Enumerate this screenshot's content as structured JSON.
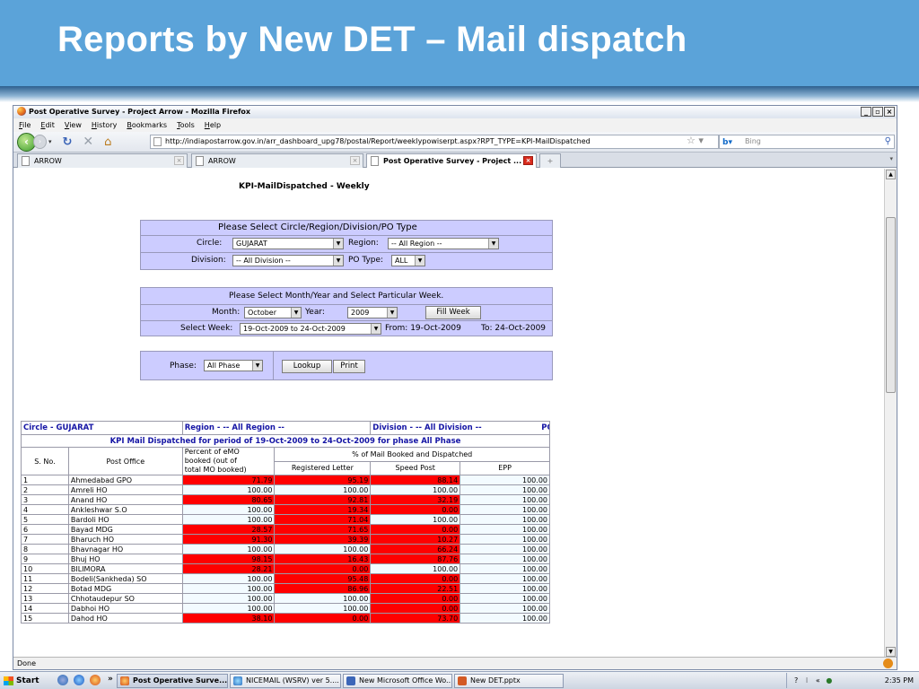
{
  "slide": {
    "title": "Reports by New DET – Mail dispatch"
  },
  "browser": {
    "window_title": "Post Operative Survey - Project Arrow - Mozilla Firefox",
    "menu": [
      "File",
      "Edit",
      "View",
      "History",
      "Bookmarks",
      "Tools",
      "Help"
    ],
    "url": "http://indiapostarrow.gov.in/arr_dashboard_upg78/postal/Report/weeklypowiserpt.aspx?RPT_TYPE=KPI-MailDispatched",
    "search_placeholder": "Bing",
    "tabs": [
      {
        "label": "ARROW"
      },
      {
        "label": "ARROW"
      },
      {
        "label": "Post Operative Survey - Project ...",
        "active": true
      }
    ],
    "new_tab": "+",
    "status": "Done"
  },
  "page": {
    "title": "KPI-MailDispatched - Weekly",
    "select_panel": {
      "header": "Please Select Circle/Region/Division/PO Type",
      "circle_label": "Circle:",
      "circle_value": "GUJARAT",
      "region_label": "Region:",
      "region_value": "-- All Region --",
      "division_label": "Division:",
      "division_value": "-- All Division --",
      "potype_label": "PO Type:",
      "potype_value": "ALL"
    },
    "week_panel": {
      "header": "Please Select Month/Year and Select Particular Week.",
      "month_label": "Month:",
      "month_value": "October",
      "year_label": "Year:",
      "year_value": "2009",
      "fill_week": "Fill Week",
      "select_week_label": "Select Week:",
      "select_week_value": "19-Oct-2009 to 24-Oct-2009",
      "from_text": "From: 19-Oct-2009",
      "to_text": "To: 24-Oct-2009"
    },
    "phase_panel": {
      "phase_label": "Phase:",
      "phase_value": "All Phase",
      "lookup": "Lookup",
      "print": "Print"
    },
    "report": {
      "circle": "Circle - GUJARAT",
      "region": "Region - -- All Region --",
      "division": "Division - -- All Division --",
      "potype": "POType - ALL",
      "period": "KPI Mail Dispatched for period of 19-Oct-2009 to 24-Oct-2009 for phase All Phase",
      "col_sno": "S. No.",
      "col_office": "Post Office",
      "col_percent": [
        "Percent of eMO",
        "booked (out of",
        "total MO booked)"
      ],
      "col_group": "% of Mail Booked and Dispatched",
      "col_registered": "Registered Letter",
      "col_speed": "Speed Post",
      "col_epp": "EPP",
      "rows": [
        {
          "sno": "1",
          "office": "Ahmedabad GPO",
          "emo": "71.79",
          "reg": "95.19",
          "speed": "88.14",
          "epp": "100.00",
          "red": [
            true,
            true,
            true
          ]
        },
        {
          "sno": "2",
          "office": "Amreli HO",
          "emo": "100.00",
          "reg": "100.00",
          "speed": "100.00",
          "epp": "100.00",
          "red": [
            false,
            false,
            false
          ]
        },
        {
          "sno": "3",
          "office": "Anand HO",
          "emo": "80.65",
          "reg": "92.81",
          "speed": "32.19",
          "epp": "100.00",
          "red": [
            true,
            true,
            true
          ]
        },
        {
          "sno": "4",
          "office": "Ankleshwar S.O",
          "emo": "100.00",
          "reg": "19.34",
          "speed": "0.00",
          "epp": "100.00",
          "red": [
            false,
            true,
            true
          ]
        },
        {
          "sno": "5",
          "office": "Bardoli HO",
          "emo": "100.00",
          "reg": "71.04",
          "speed": "100.00",
          "epp": "100.00",
          "red": [
            false,
            true,
            false
          ]
        },
        {
          "sno": "6",
          "office": "Bayad MDG",
          "emo": "28.57",
          "reg": "71.65",
          "speed": "0.00",
          "epp": "100.00",
          "red": [
            true,
            true,
            true
          ]
        },
        {
          "sno": "7",
          "office": "Bharuch HO",
          "emo": "91.30",
          "reg": "39.39",
          "speed": "10.27",
          "epp": "100.00",
          "red": [
            true,
            true,
            true
          ]
        },
        {
          "sno": "8",
          "office": "Bhavnagar HO",
          "emo": "100.00",
          "reg": "100.00",
          "speed": "66.24",
          "epp": "100.00",
          "red": [
            false,
            false,
            true
          ]
        },
        {
          "sno": "9",
          "office": "Bhuj HO",
          "emo": "98.15",
          "reg": "16.43",
          "speed": "87.76",
          "epp": "100.00",
          "red": [
            true,
            true,
            true
          ]
        },
        {
          "sno": "10",
          "office": "BILIMORA",
          "emo": "28.21",
          "reg": "0.00",
          "speed": "100.00",
          "epp": "100.00",
          "red": [
            true,
            true,
            false
          ]
        },
        {
          "sno": "11",
          "office": "Bodeli(Sankheda) SO",
          "emo": "100.00",
          "reg": "95.48",
          "speed": "0.00",
          "epp": "100.00",
          "red": [
            false,
            true,
            true
          ]
        },
        {
          "sno": "12",
          "office": "Botad MDG",
          "emo": "100.00",
          "reg": "86.96",
          "speed": "22.51",
          "epp": "100.00",
          "red": [
            false,
            true,
            true
          ]
        },
        {
          "sno": "13",
          "office": "Chhotaudepur SO",
          "emo": "100.00",
          "reg": "100.00",
          "speed": "0.00",
          "epp": "100.00",
          "red": [
            false,
            false,
            true
          ]
        },
        {
          "sno": "14",
          "office": "Dabhoi HO",
          "emo": "100.00",
          "reg": "100.00",
          "speed": "0.00",
          "epp": "100.00",
          "red": [
            false,
            false,
            true
          ]
        },
        {
          "sno": "15",
          "office": "Dahod HO",
          "emo": "38.10",
          "reg": "0.00",
          "speed": "73.70",
          "epp": "100.00",
          "red": [
            true,
            true,
            true
          ]
        }
      ]
    }
  },
  "taskbar": {
    "start": "Start",
    "tasks": [
      {
        "label": "Post Operative Surve...",
        "active": true
      },
      {
        "label": "NICEMAIL (WSRV) ver 5...."
      },
      {
        "label": "New Microsoft Office Wo..."
      },
      {
        "label": "New DET.pptx"
      }
    ],
    "clock": "2:35 PM"
  }
}
